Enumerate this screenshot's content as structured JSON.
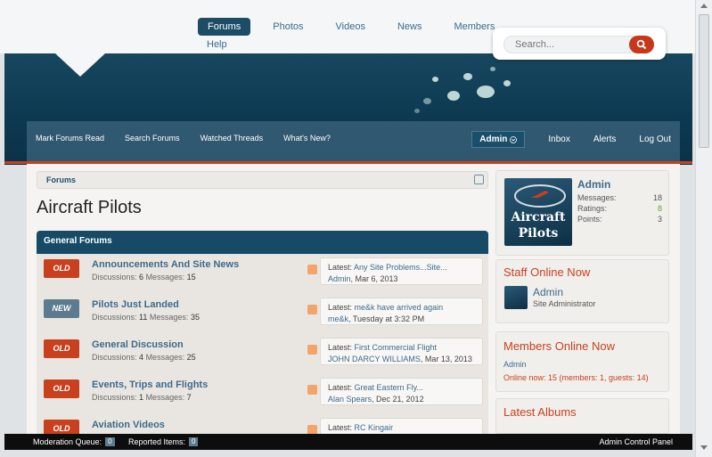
{
  "nav": {
    "tabs": [
      {
        "label": "Forums",
        "active": true
      },
      {
        "label": "Photos",
        "active": false
      },
      {
        "label": "Videos",
        "active": false
      },
      {
        "label": "News",
        "active": false
      },
      {
        "label": "Members",
        "active": false
      }
    ],
    "help_label": "Help"
  },
  "search": {
    "placeholder": "Search...",
    "icon": "search-icon"
  },
  "subnav": {
    "links": [
      "Mark Forums Read",
      "Search Forums",
      "Watched Threads",
      "What's New?"
    ],
    "admin_label": "Admin",
    "inbox_label": "Inbox",
    "alerts_label": "Alerts",
    "logout_label": "Log Out"
  },
  "breadcrumb": {
    "crumb": "Forums"
  },
  "page_title": "Aircraft Pilots",
  "category": {
    "title": "General Forums"
  },
  "forums": [
    {
      "badge": "OLD",
      "title": "Announcements And Site News",
      "discussions_label": "Discussions:",
      "discussions": "6",
      "messages_label": "Messages:",
      "messages": "15",
      "latest_prefix": "Latest:",
      "latest_title": "Any Site Problems...Site...",
      "latest_user": "Admin",
      "latest_date": ", Mar 6, 2013"
    },
    {
      "badge": "NEW",
      "title": "Pilots Just Landed",
      "discussions_label": "Discussions:",
      "discussions": "11",
      "messages_label": "Messages:",
      "messages": "35",
      "latest_prefix": "Latest:",
      "latest_title": "me&k have arrived again",
      "latest_user": "me&k",
      "latest_date": ", Tuesday at 3:32 PM"
    },
    {
      "badge": "OLD",
      "title": "General Discussion",
      "discussions_label": "Discussions:",
      "discussions": "4",
      "messages_label": "Messages:",
      "messages": "25",
      "latest_prefix": "Latest:",
      "latest_title": "First Commercial Flight",
      "latest_user": "JOHN DARCY WILLIAMS",
      "latest_date": ", Mar 13, 2013"
    },
    {
      "badge": "OLD",
      "title": "Events, Trips and Flights",
      "discussions_label": "Discussions:",
      "discussions": "1",
      "messages_label": "Messages:",
      "messages": "7",
      "latest_prefix": "Latest:",
      "latest_title": "Great Eastern Fly...",
      "latest_user": "Alan Spears",
      "latest_date": ", Dec 21, 2012"
    },
    {
      "badge": "OLD",
      "title": "Aviation Videos",
      "discussions_label": "",
      "discussions": "",
      "messages_label": "",
      "messages": "",
      "latest_prefix": "Latest:",
      "latest_title": "RC Kingair",
      "latest_user": "",
      "latest_date": ""
    }
  ],
  "visitor": {
    "name": "Admin",
    "avatar_text_1": "Aircraft",
    "avatar_text_2": "Pilots",
    "messages_label": "Messages:",
    "messages": "18",
    "ratings_label": "Ratings:",
    "ratings": "8",
    "points_label": "Points:",
    "points": "3"
  },
  "staff_online": {
    "title": "Staff Online Now",
    "name": "Admin",
    "role": "Site Administrator"
  },
  "members_online": {
    "title": "Members Online Now",
    "member": "Admin",
    "summary": "Online now: 15 (members: 1, guests: 14)"
  },
  "latest_albums": {
    "title": "Latest Albums"
  },
  "bottombar": {
    "moderation_label": "Moderation Queue:",
    "moderation_count": "0",
    "reported_label": "Reported Items:",
    "reported_count": "0",
    "acp_label": "Admin Control Panel"
  },
  "colors": {
    "accent": "#c8401e",
    "brand": "#164a66",
    "link": "#3e6a8c"
  }
}
